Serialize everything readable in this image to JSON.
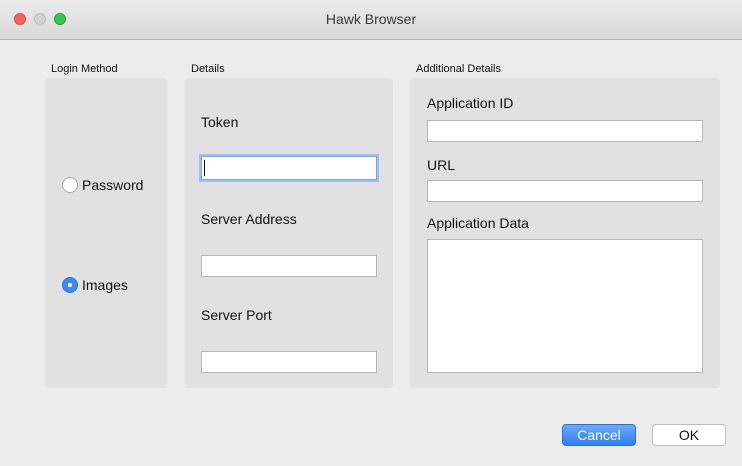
{
  "window": {
    "title": "Hawk Browser"
  },
  "login_method": {
    "label": "Login Method",
    "options": [
      {
        "label": "Password",
        "selected": false
      },
      {
        "label": "Images",
        "selected": true
      }
    ]
  },
  "details": {
    "label": "Details",
    "token": {
      "label": "Token",
      "value": ""
    },
    "server_address": {
      "label": "Server Address",
      "value": ""
    },
    "server_port": {
      "label": "Server Port",
      "value": ""
    }
  },
  "additional_details": {
    "label": "Additional Details",
    "application_id": {
      "label": "Application ID",
      "value": ""
    },
    "url": {
      "label": "URL",
      "value": ""
    },
    "application_data": {
      "label": "Application Data",
      "value": ""
    }
  },
  "buttons": {
    "cancel": "Cancel",
    "ok": "OK"
  },
  "colors": {
    "accent": "#3d8af7",
    "panel": "#e1e1e1",
    "window": "#ececec"
  }
}
